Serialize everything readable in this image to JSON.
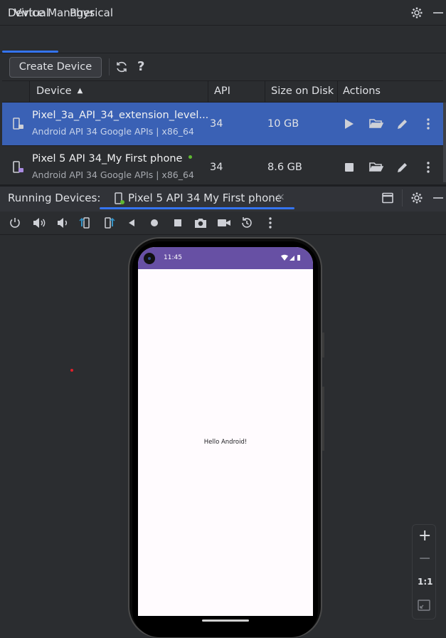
{
  "device_manager": {
    "title": "Device Manager",
    "tabs": [
      {
        "label": "Virtual",
        "selected": true
      },
      {
        "label": "Physical",
        "selected": false
      }
    ],
    "create_button": "Create Device",
    "help": "?",
    "columns": {
      "device": "Device",
      "api": "API",
      "size": "Size on Disk",
      "actions": "Actions"
    },
    "devices": [
      {
        "name": "Pixel_3a_API_34_extension_level...",
        "subtitle": "Android API 34 Google APIs | x86_64",
        "api": "34",
        "size": "10 GB",
        "selected": true,
        "running": false
      },
      {
        "name": "Pixel 5 API 34_My First phone",
        "subtitle": "Android API 34 Google APIs | x86_64",
        "api": "34",
        "size": "8.6 GB",
        "selected": false,
        "running": true
      }
    ]
  },
  "running_devices": {
    "label": "Running Devices:",
    "tab_label": "Pixel 5 API 34 My First phone",
    "close": "×"
  },
  "emulator": {
    "clock": "11:45",
    "app_text": "Hello Android!",
    "status_bar_color": "#6750a4",
    "zoom": {
      "in": "+",
      "out": "−",
      "actual": "1:1"
    }
  },
  "colors": {
    "accent": "#3574f0",
    "selection": "#3a61b5",
    "online": "#5fb832"
  }
}
